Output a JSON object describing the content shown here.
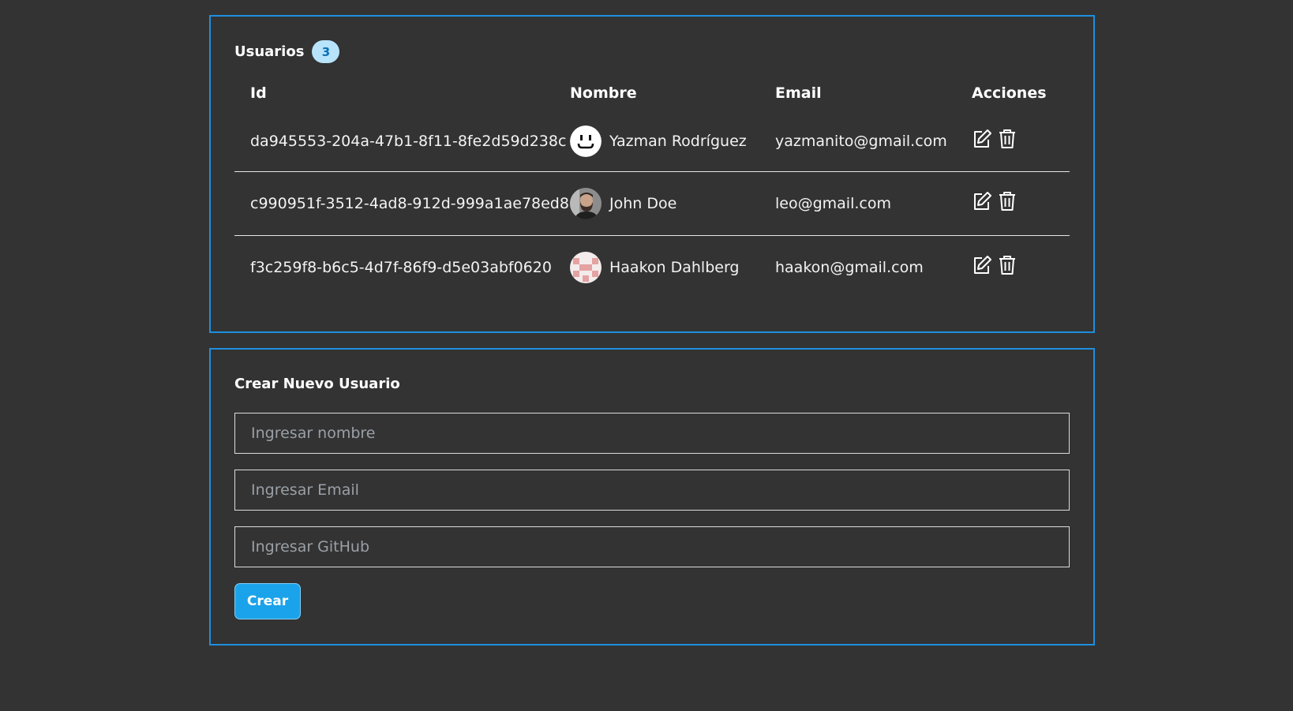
{
  "users_panel": {
    "title": "Usuarios",
    "count": "3",
    "columns": {
      "id": "Id",
      "name": "Nombre",
      "email": "Email",
      "actions": "Acciones"
    },
    "rows": [
      {
        "id": "da945553-204a-47b1-8f11-8fe2d59d238c",
        "name": "Yazman Rodríguez",
        "email": "yazmanito@gmail.com",
        "avatar": "smiley-face-avatar"
      },
      {
        "id": "c990951f-3512-4ad8-912d-999a1ae78ed8",
        "name": "John Doe",
        "email": "leo@gmail.com",
        "avatar": "bearded-man-photo-avatar"
      },
      {
        "id": "f3c259f8-b6c5-4d7f-86f9-d5e03abf0620",
        "name": "Haakon Dahlberg",
        "email": "haakon@gmail.com",
        "avatar": "pink-pattern-avatar"
      }
    ],
    "action_icons": [
      "edit-icon",
      "trash-icon"
    ]
  },
  "create_panel": {
    "title": "Crear Nuevo Usuario",
    "name_placeholder": "Ingresar nombre",
    "email_placeholder": "Ingresar Email",
    "github_placeholder": "Ingresar GitHub",
    "submit_label": "Crear"
  },
  "colors": {
    "background": "#333333",
    "border_accent": "#1e8fe0",
    "badge_bg": "#b7e3fb",
    "badge_text": "#0a6fb4",
    "button_bg": "#1aa3ea"
  }
}
